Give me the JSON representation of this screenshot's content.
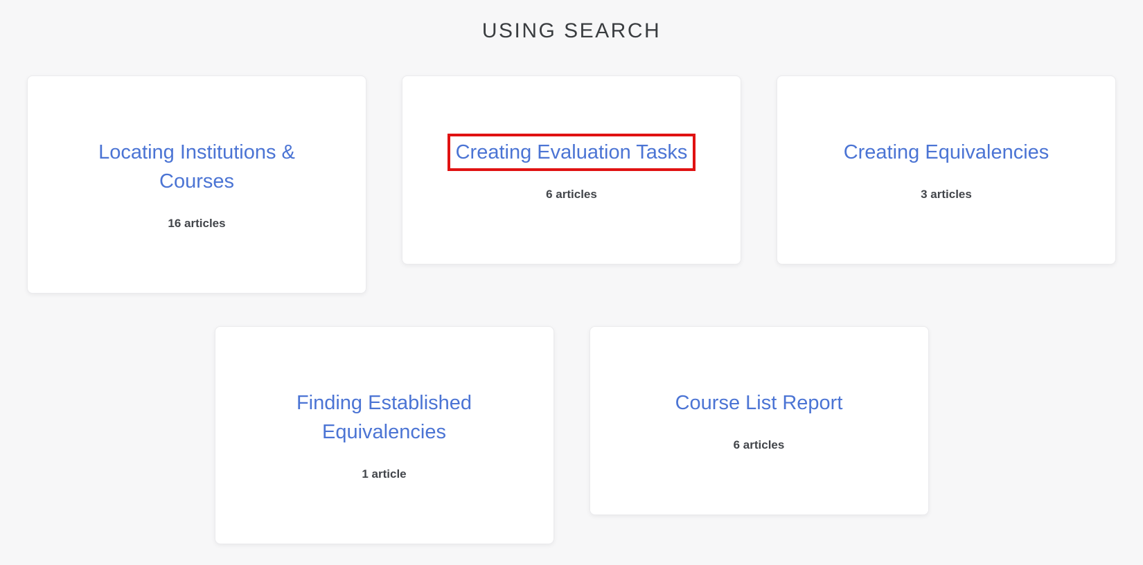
{
  "page": {
    "heading": "USING SEARCH",
    "background_color": "#f7f7f8"
  },
  "colors": {
    "link_blue": "#4b74d4",
    "count_text": "#42454a",
    "heading_text": "#3a3d40",
    "card_background": "#ffffff",
    "card_border": "#ebebed",
    "annotation_red": "#e01212"
  },
  "annotation": {
    "type": "red-rectangle-highlight",
    "target": "Creating Evaluation Tasks"
  },
  "collections": {
    "rows": [
      {
        "cards": [
          {
            "title": "Locating Institutions & Courses",
            "count_label": "16 articles",
            "highlighted": false
          },
          {
            "title": "Creating Evaluation Tasks",
            "count_label": "6 articles",
            "highlighted": true
          },
          {
            "title": "Creating Equivalencies",
            "count_label": "3 articles",
            "highlighted": false
          }
        ]
      },
      {
        "cards": [
          {
            "title": "Finding Established Equivalencies",
            "count_label": "1 article",
            "highlighted": false
          },
          {
            "title": "Course List Report",
            "count_label": "6 articles",
            "highlighted": false
          }
        ]
      }
    ]
  }
}
